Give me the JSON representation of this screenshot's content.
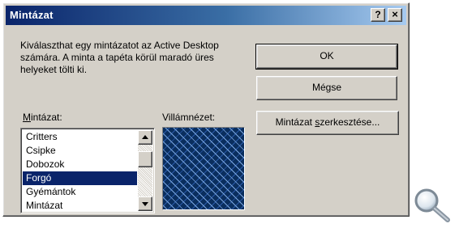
{
  "window": {
    "title": "Mintázat",
    "help_label": "?",
    "close_label": "×"
  },
  "description": "Kiválaszthat egy mintázatot az Active Desktop számára. A minta a tapéta körül maradó üres helyeket tölti ki.",
  "buttons": {
    "ok": "OK",
    "cancel": "Mégse",
    "edit_prefix": "Mintázat ",
    "edit_accel": "s",
    "edit_suffix": "zerkesztése..."
  },
  "pattern_list": {
    "label_accel": "M",
    "label_rest": "intázat:",
    "items": [
      "Critters",
      "Csipke",
      "Dobozok",
      "Forgó",
      "Gyémántok",
      "Mintázat"
    ],
    "selected": "Forgó"
  },
  "preview": {
    "label": "Villámnézet:"
  },
  "icons": {
    "scroll_up": "arrow-up-icon",
    "scroll_down": "arrow-down-icon",
    "magnifier": "magnifier-icon"
  },
  "colors": {
    "title_bar": "#0a246a",
    "selection": "#0a246a",
    "dialog_face": "#d4d0c8"
  }
}
